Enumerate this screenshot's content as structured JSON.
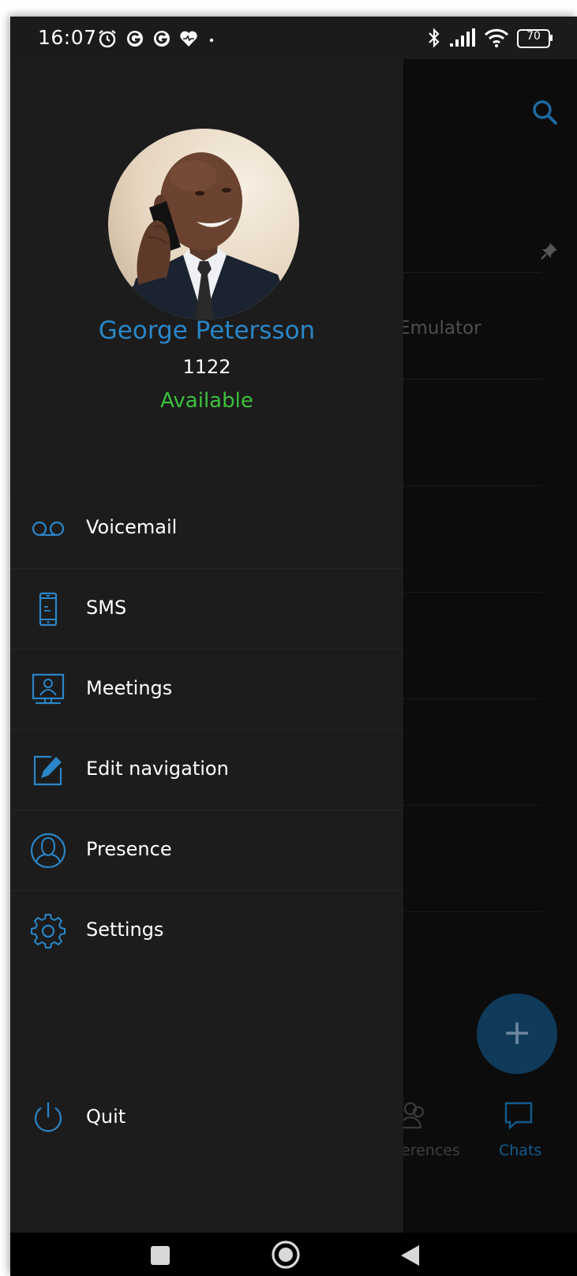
{
  "status_bar": {
    "time": "16:07",
    "battery": "70",
    "left_icons": [
      "alarm-icon",
      "g-icon",
      "g-icon",
      "heart-icon",
      "dot-icon"
    ],
    "right_icons": [
      "bluetooth-icon",
      "signal-icon",
      "wifi-icon",
      "battery-icon"
    ]
  },
  "profile": {
    "name": "George Petersson",
    "extension": "1122",
    "status": "Available",
    "status_color": "#3cc13c",
    "name_color": "#2a86c8"
  },
  "menu": {
    "items": [
      {
        "label": "Voicemail",
        "icon": "voicemail-icon"
      },
      {
        "label": "SMS",
        "icon": "phone-icon"
      },
      {
        "label": "Meetings",
        "icon": "meeting-icon"
      },
      {
        "label": "Edit navigation",
        "icon": "edit-icon"
      },
      {
        "label": "Presence",
        "icon": "presence-icon"
      },
      {
        "label": "Settings",
        "icon": "gear-icon"
      }
    ],
    "quit_label": "Quit"
  },
  "background_app": {
    "emulator_text": "Emulator",
    "fab_label": "+",
    "tabs": [
      {
        "label": "erences",
        "icon": "conference-icon"
      },
      {
        "label": "Chats",
        "icon": "chat-icon"
      }
    ]
  },
  "colors": {
    "accent": "#2a86c8",
    "drawer_bg": "#1c1c1c",
    "fab_bg": "#0f3a5a"
  }
}
